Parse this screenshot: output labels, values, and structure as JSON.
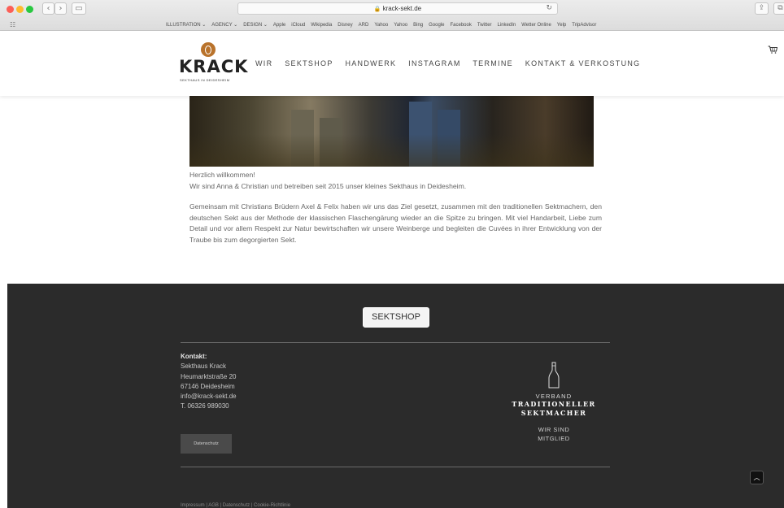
{
  "browser": {
    "url": "krack-sekt.de",
    "bookmarks": [
      "ILLUSTRATION ⌄",
      "AGENCY ⌄",
      "DESIGN ⌄",
      "Apple",
      "iCloud",
      "Wikipedia",
      "Disney",
      "ARD",
      "Yahoo",
      "Yahoo",
      "Bing",
      "Google",
      "Facebook",
      "Twitter",
      "LinkedIn",
      "Wetter Online",
      "Yelp",
      "TripAdvisor"
    ]
  },
  "header": {
    "logo_word": "KRACK",
    "logo_sub": "SEKTHAUS IN DEIDESHEIM",
    "nav": [
      "WIR",
      "SEKTSHOP",
      "HANDWERK",
      "INSTAGRAM",
      "TERMINE",
      "KONTAKT & VERKOSTUNG"
    ]
  },
  "intro": {
    "greeting": "Herzlich willkommen!",
    "line2": "Wir sind Anna & Christian und betreiben seit 2015 unser kleines Sekthaus in Deidesheim.",
    "paragraph": "Gemeinsam mit Christians Brüdern Axel & Felix haben wir uns das Ziel gesetzt, zusammen mit den traditionellen Sektmachern, den deutschen Sekt aus der Methode der klassischen Flaschengärung wieder an die Spitze zu bringen. Mit viel Handarbeit, Liebe zum Detail und vor allem Respekt zur Natur bewirtschaften wir unsere Weinberge und begleiten die Cuvées in ihrer Entwicklung von der Traube bis zum degorgierten Sekt."
  },
  "footer": {
    "shop_button": "SEKTSHOP",
    "contact_label": "Kontakt:",
    "contact_lines": [
      "Sekthaus Krack",
      "Heumarktstraße 20",
      "67146 Deidesheim",
      "info@krack-sekt.de",
      "T. 06326 989030"
    ],
    "privacy_button": "Datenschutz",
    "verband_line1": "VERBAND",
    "verband_line2": "TRADITIONELLER",
    "verband_line3": "SEKTMACHER",
    "member_line1": "WIR SIND",
    "member_line2": "MITGLIED",
    "legal": "Impressum | AGB | Datenschutz | Cookie-Richtlinie"
  },
  "icons": {
    "cart": "shopping-cart-icon",
    "to_top": "chevron-up-icon",
    "bottle": "bottle-icon"
  }
}
